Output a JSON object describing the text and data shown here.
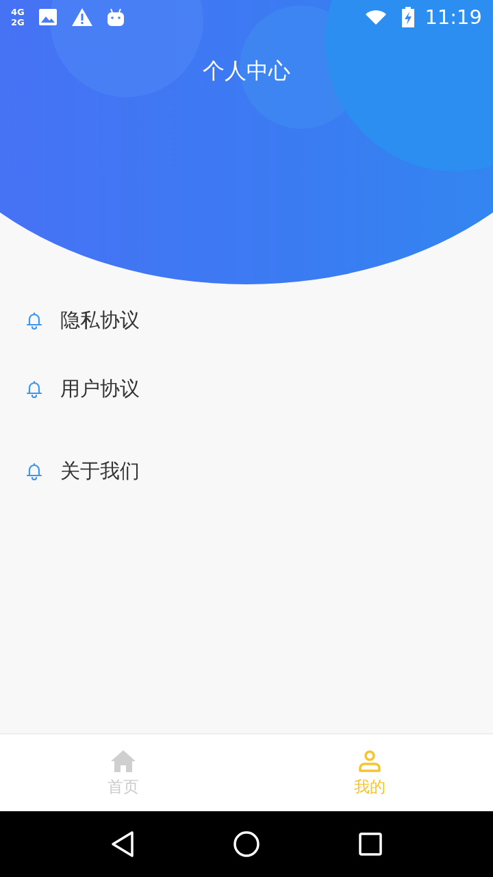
{
  "status_bar": {
    "network_top": "4G",
    "network_bottom": "2G",
    "time": "11:19"
  },
  "header": {
    "title": "个人中心"
  },
  "menu_groups": [
    {
      "items": [
        {
          "label": "隐私协议"
        },
        {
          "label": "用户协议"
        }
      ]
    },
    {
      "items": [
        {
          "label": "关于我们"
        }
      ]
    }
  ],
  "tabs": [
    {
      "label": "首页",
      "kind": "home",
      "selected": false
    },
    {
      "label": "我的",
      "kind": "person",
      "selected": true
    }
  ]
}
